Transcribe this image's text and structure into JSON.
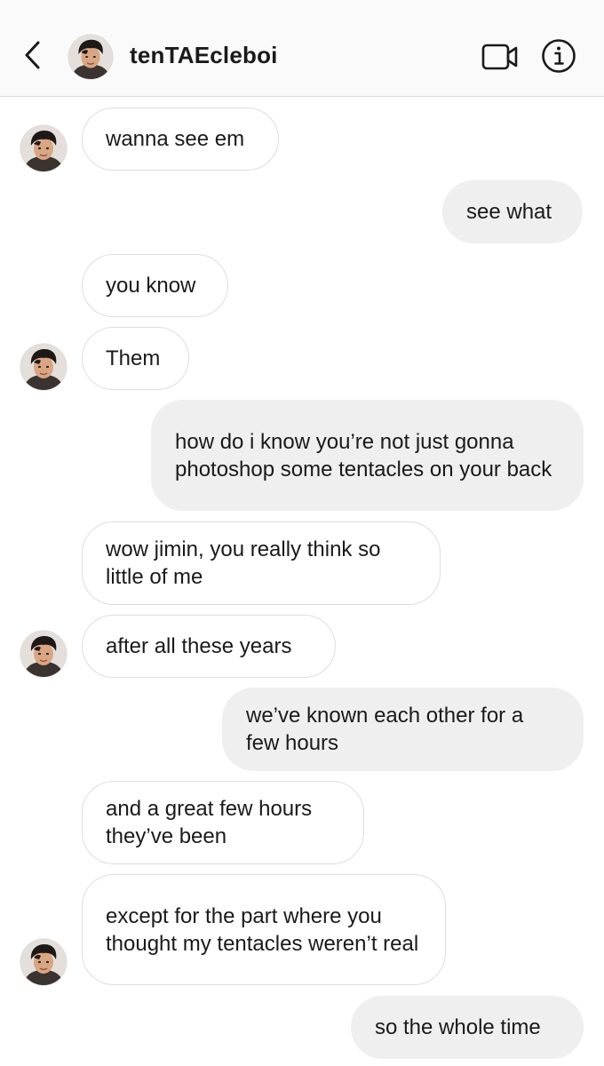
{
  "header": {
    "username": "tenTAEcleboi",
    "back_icon": "chevron-left-icon",
    "video_icon": "video-camera-icon",
    "info_icon": "info-icon"
  },
  "messages": [
    {
      "sender": "them",
      "text": "wanna see em"
    },
    {
      "sender": "me",
      "text": "see what"
    },
    {
      "sender": "them",
      "text": "you know"
    },
    {
      "sender": "them",
      "text": "Them"
    },
    {
      "sender": "me",
      "text": "how do i know you’re not just gonna photoshop some tentacles on your back"
    },
    {
      "sender": "them",
      "text": "wow jimin, you really think so little of me"
    },
    {
      "sender": "them",
      "text": "after all these years"
    },
    {
      "sender": "me",
      "text": "we’ve known each other for a few hours"
    },
    {
      "sender": "them",
      "text": "and a great few hours they’ve been"
    },
    {
      "sender": "them",
      "text": "except for the part where you thought my tentacles weren’t real"
    },
    {
      "sender": "me",
      "text": "so the whole time"
    }
  ],
  "colors": {
    "header_bg": "#fafafa",
    "incoming_border": "#dedede",
    "outgoing_bg": "#efefef",
    "text": "#1a1a1a"
  }
}
